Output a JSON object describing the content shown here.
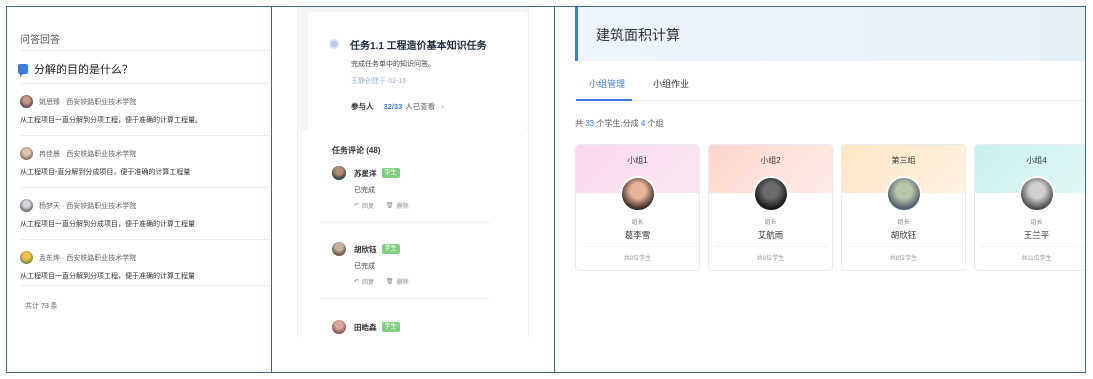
{
  "qa_panel": {
    "title": "问答回答",
    "question": "分解的目的是什么？",
    "answers": [
      {
        "author": "姚思臻 · 西安铁路职业技术学院",
        "text": "从工程项目一直分解到分项工程，便于准确的计算工程量。"
      },
      {
        "author": "冉佳晨 · 西安铁路职业技术学院",
        "text": "从工程项目-直分解到分成项目，便于准确的计算工程量"
      },
      {
        "author": "杨梦天 · 西安铁路职业技术学院",
        "text": "从工程项目一直分解到分成项目，便于准确的计算工程量"
      },
      {
        "author": "孟东烨 · 西安铁路职业技术学院",
        "text": "从工程项目一直分解到分项工程，便于准确的计算工程量"
      }
    ],
    "total": "共计 73 条"
  },
  "task_panel": {
    "task_title": "任务1.1 工程造价基本知识任务",
    "task_desc": "完成任务单中的知识问答。",
    "task_meta": "王静创建于·02-16",
    "participants_label": "参与人",
    "participants_count": "32/33",
    "participants_rest": "人已查看",
    "participants_chevron": "›",
    "comments_title": "任务评论 (48)",
    "comments": [
      {
        "name": "苏星洋",
        "badge": "学生",
        "text": "已完成",
        "reply": "回复",
        "delete": "删除"
      },
      {
        "name": "胡欣钰",
        "badge": "学生",
        "text": "已完成",
        "reply": "回复",
        "delete": "删除"
      },
      {
        "name": "田皓森",
        "badge": "学生"
      }
    ]
  },
  "group_panel": {
    "title": "建筑面积计算",
    "tabs": [
      "小组管理",
      "小组作业"
    ],
    "summary_prefix": "共",
    "student_count": "33",
    "summary_mid": "个学生,分成",
    "group_count": "4",
    "summary_suffix": "个组",
    "groups": [
      {
        "name": "小组1",
        "role": "组长",
        "leader": "葛李雪",
        "count": "共8位学生",
        "color": "#f9d8ec"
      },
      {
        "name": "小组2",
        "role": "组长",
        "leader": "艾航雨",
        "count": "共6位学生",
        "color": "#fde0d8"
      },
      {
        "name": "第三组",
        "role": "组长",
        "leader": "胡欣钰",
        "count": "共8位学生",
        "color": "#fdebd2"
      },
      {
        "name": "小组4",
        "role": "组长",
        "leader": "王兰平",
        "count": "共11位学生",
        "color": "#d4f3f1"
      }
    ]
  }
}
